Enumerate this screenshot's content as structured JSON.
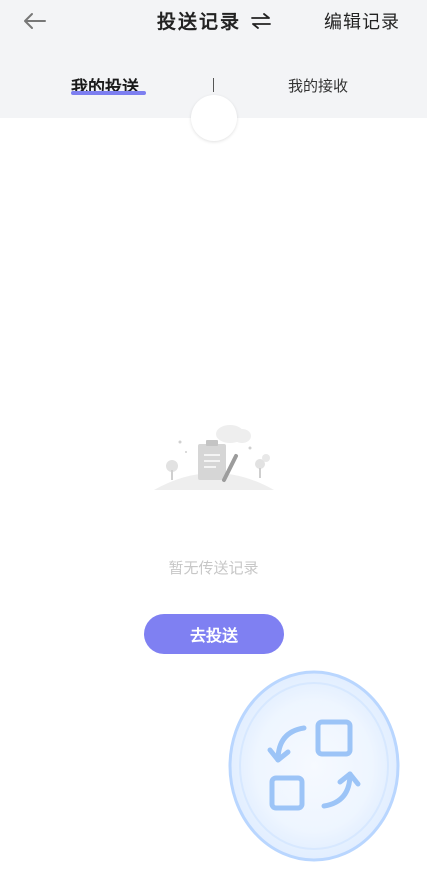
{
  "header": {
    "title": "投送记录",
    "edit_label": "编辑记录",
    "back_icon": "back-arrow-icon",
    "swap_icon": "swap-arrows-icon"
  },
  "tabs": {
    "mine": "我的投送",
    "received": "我的接收"
  },
  "empty_state": {
    "message": "暂无传送记录",
    "action_label": "去投送",
    "illustration": "empty-document-illustration"
  },
  "floating_action": {
    "icon": "transfer-swap-icon"
  },
  "colors": {
    "accent": "#7f80f2",
    "tab_indicator": "#7d7ff0",
    "header_bg": "#f3f4f6",
    "empty_text": "#c7c7c7"
  }
}
